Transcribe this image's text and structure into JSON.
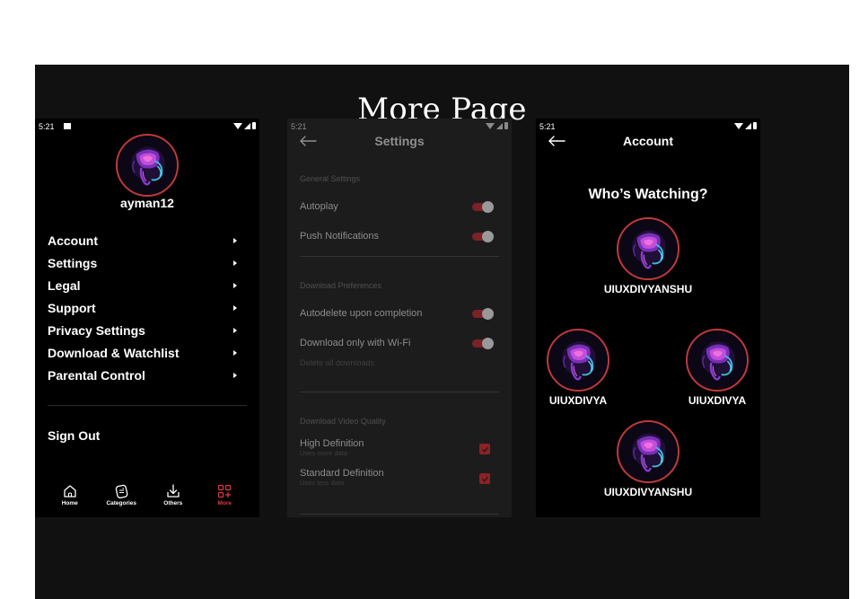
{
  "board": {
    "title": "More Page"
  },
  "more_screen": {
    "status_time": "5:21",
    "username": "ayman12",
    "menu": [
      {
        "label": "Account"
      },
      {
        "label": "Settings"
      },
      {
        "label": "Legal"
      },
      {
        "label": "Support"
      },
      {
        "label": "Privacy Settings"
      },
      {
        "label": "Download & Watchlist"
      },
      {
        "label": "Parental Control"
      }
    ],
    "sign_out": "Sign Out",
    "tabs": [
      {
        "label": "Home",
        "icon": "home-icon"
      },
      {
        "label": "Categories",
        "icon": "categories-icon"
      },
      {
        "label": "Others",
        "icon": "download-icon"
      },
      {
        "label": "More",
        "icon": "grid-plus-icon",
        "active": true
      }
    ]
  },
  "settings_screen": {
    "status_time": "5:21",
    "title": "Settings",
    "general_header": "General Settings",
    "autoplay": "Autoplay",
    "push_notifications": "Push Notifications",
    "download_header": "Download Preferences",
    "autodelete": "Autodelete upon completion",
    "wifi_only": "Download only with Wi-Fi",
    "delete_all": "Delete all downloads",
    "quality_header": "Download Video Quality",
    "high_def": "High Definition",
    "high_def_sub": "Uses more data",
    "std_def": "Standard Definition",
    "std_def_sub": "Uses less data"
  },
  "account_screen": {
    "status_time": "5:21",
    "title": "Account",
    "heading": "Who’s Watching?",
    "profiles": [
      "UIUXDIVYANSHU",
      "UIUXDIVYA",
      "UIUXDIVYA",
      "UIUXDIVYANSHU"
    ]
  },
  "colors": {
    "accent": "#e03a3e",
    "ring": "#c0393b",
    "board": "#111111",
    "settings_bg": "#1c1c1c"
  }
}
